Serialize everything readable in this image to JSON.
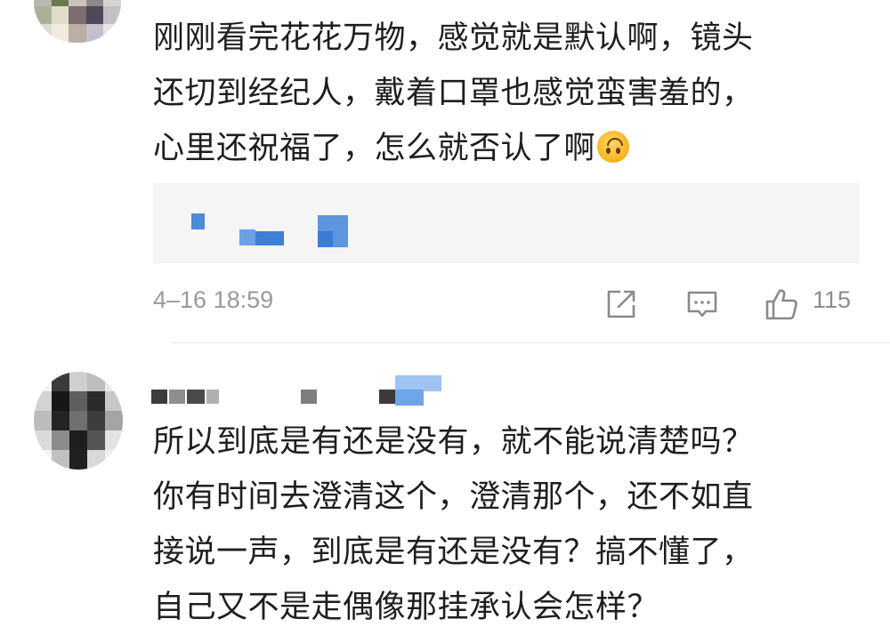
{
  "comment1": {
    "lines": [
      "刚刚看完花花万物，感觉就是默认啊，镜头",
      "还切到经纪人，戴着口罩也感觉蛮害羞的，",
      "心里还祝福了，怎么就否认了啊"
    ],
    "emoji": "upside-down-face-emoji",
    "time": "4–16 18:59",
    "like_count": "115",
    "icons": [
      "share-icon",
      "comment-icon",
      "like-icon"
    ]
  },
  "comment2": {
    "lines": [
      "所以到底是有还是没有，就不能说清楚吗？",
      "你有时间去澄清这个，澄清那个，还不如直",
      "接说一声，到底是有还是没有？搞不懂了，",
      "自己又不是走偶像那挂承认会怎样？"
    ]
  },
  "colors": {
    "text": "#1e1e1e",
    "meta": "#9a9a9a",
    "quote_bg": "#f5f5f5",
    "pixel_blue": "#3f7fd6"
  }
}
